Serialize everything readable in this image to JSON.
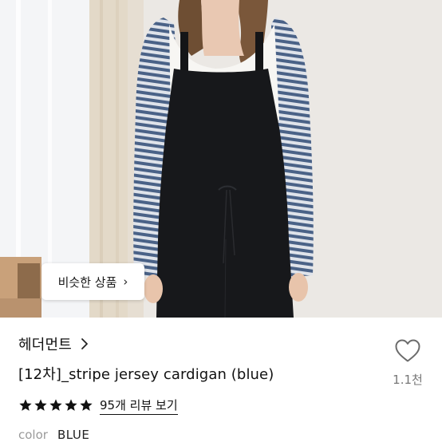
{
  "photo": {
    "alt_description": "",
    "similar_button": {
      "label": "비슷한 상품",
      "chevron": "›"
    }
  },
  "product": {
    "brand": "헤더먼트",
    "title": "[12차]_stripe jersey cardigan (blue)",
    "rating": {
      "stars": 5,
      "review_link": "95개 리뷰 보기"
    },
    "color": {
      "label": "color",
      "value": "BLUE"
    }
  },
  "like": {
    "icon": "heart-outline-icon",
    "count": "1.1천"
  },
  "colors": {
    "star": "#111111",
    "heart_stroke": "#6b6b6b",
    "muted_text": "#9a9a9a"
  }
}
